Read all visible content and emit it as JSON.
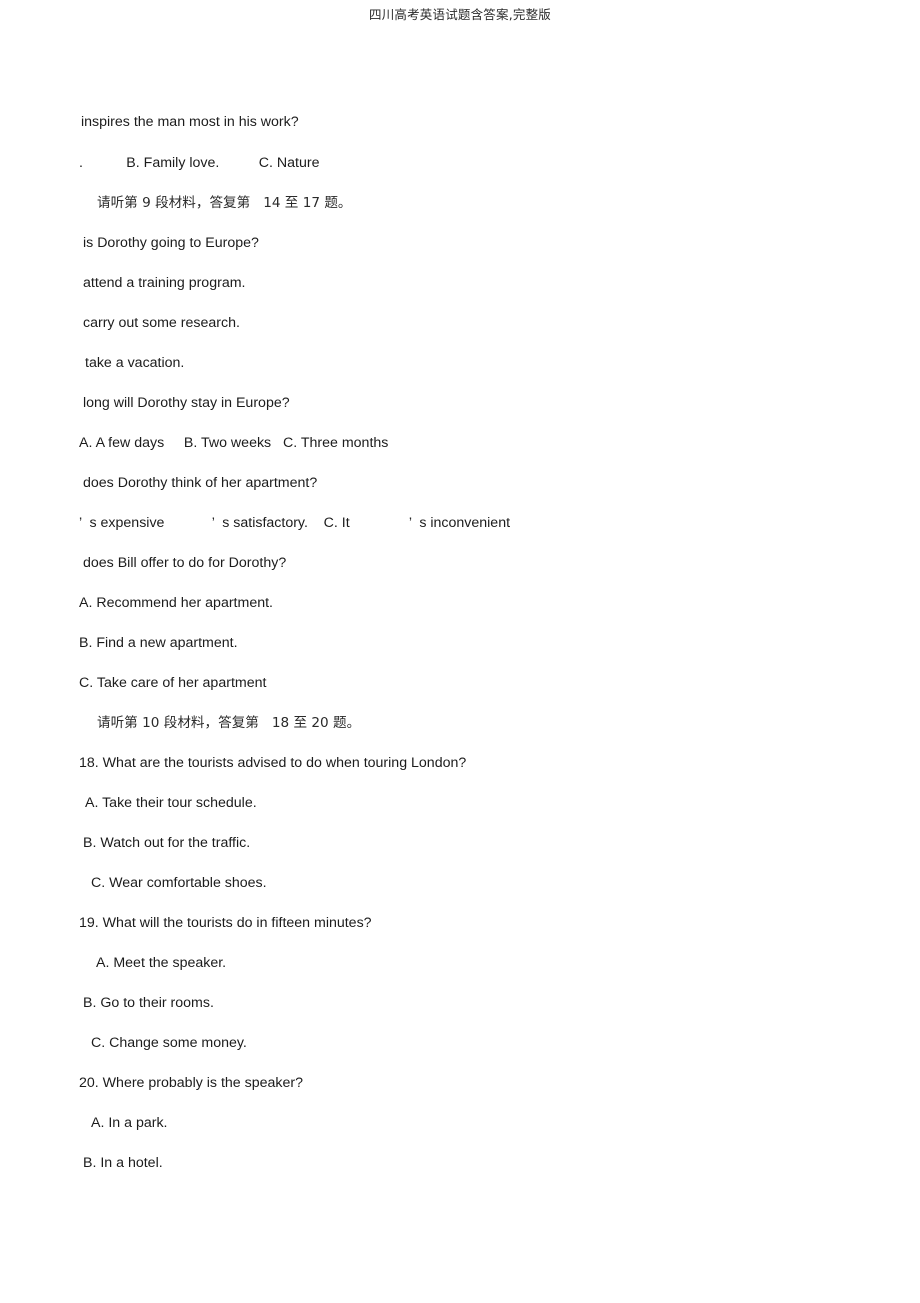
{
  "header": {
    "running_title": "四川高考英语试题含答案,完整版"
  },
  "document": {
    "lines": [
      {
        "id": "q13-stem-fragment",
        "text": "inspires the man most in his work?",
        "indent": "ind-1"
      },
      {
        "id": "q13-options",
        "text": ".           B. Family love.          C. Nature",
        "indent": "ind-0"
      },
      {
        "id": "instruction-9",
        "text": "请听第 9 段材料，答复第   14 至 17 题。",
        "indent": "ind-ch",
        "cn": true
      },
      {
        "id": "q14-stem-fragment",
        "text": "is Dorothy going to Europe?",
        "indent": "ind-2"
      },
      {
        "id": "q14-option-a-fragment",
        "text": "attend a training program.",
        "indent": "ind-2"
      },
      {
        "id": "q14-option-b-fragment",
        "text": "carry out some research.",
        "indent": "ind-2"
      },
      {
        "id": "q14-option-c-fragment",
        "text": "take a vacation.",
        "indent": "ind-3"
      },
      {
        "id": "q15-stem-fragment",
        "text": "long will Dorothy stay in Europe?",
        "indent": "ind-2"
      },
      {
        "id": "q15-options",
        "text": "A. A few days     B. Two weeks   C. Three months",
        "indent": "ind-0"
      },
      {
        "id": "q16-stem-fragment",
        "text": "does Dorothy think of her apartment?",
        "indent": "ind-2"
      },
      {
        "id": "q16-options",
        "text": "’  s expensive            ’  s satisfactory.    C. It               ’  s inconvenient",
        "indent": "ind-0"
      },
      {
        "id": "q17-stem-fragment",
        "text": "does Bill offer to do for Dorothy?",
        "indent": "ind-2"
      },
      {
        "id": "q17-option-a",
        "text": "A. Recommend her apartment.",
        "indent": "ind-0"
      },
      {
        "id": "q17-option-b",
        "text": "B. Find a new apartment.",
        "indent": "ind-0"
      },
      {
        "id": "q17-option-c",
        "text": "C. Take care of her apartment",
        "indent": "ind-0"
      },
      {
        "id": "instruction-10",
        "text": "请听第 10 段材料，答复第   18 至 20 题。",
        "indent": "ind-ch",
        "cn": true
      },
      {
        "id": "q18-stem",
        "text": "18. What are the tourists advised to do when touring London?",
        "indent": "ind-0"
      },
      {
        "id": "q18-option-a",
        "text": "A. Take their tour schedule.",
        "indent": "ind-3"
      },
      {
        "id": "q18-option-b",
        "text": "B. Watch out for the traffic.",
        "indent": "ind-2"
      },
      {
        "id": "q18-option-c",
        "text": "C. Wear comfortable shoes.",
        "indent": "ind-5"
      },
      {
        "id": "q19-stem",
        "text": "19. What will the tourists do in fifteen minutes?",
        "indent": "ind-0"
      },
      {
        "id": "q19-option-a",
        "text": "A. Meet the speaker.",
        "indent": "ind-6"
      },
      {
        "id": "q19-option-b",
        "text": "B. Go to their rooms.",
        "indent": "ind-2"
      },
      {
        "id": "q19-option-c",
        "text": "C. Change some money.",
        "indent": "ind-5"
      },
      {
        "id": "q20-stem",
        "text": "20. Where probably is the speaker?",
        "indent": "ind-0"
      },
      {
        "id": "q20-option-a",
        "text": "A. In a park.",
        "indent": "ind-5"
      },
      {
        "id": "q20-option-b",
        "text": "B. In a hotel.",
        "indent": "ind-2"
      }
    ]
  }
}
